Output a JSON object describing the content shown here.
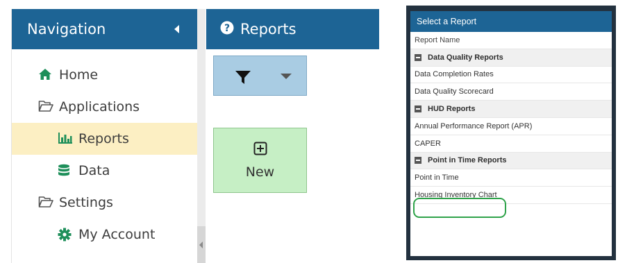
{
  "navigation": {
    "title": "Navigation",
    "items": [
      {
        "label": "Home",
        "icon": "home-icon"
      },
      {
        "label": "Applications",
        "icon": "folder-open-icon"
      },
      {
        "label": "Reports",
        "icon": "bar-chart-icon",
        "active": true
      },
      {
        "label": "Data",
        "icon": "database-icon"
      },
      {
        "label": "Settings",
        "icon": "folder-open-icon"
      },
      {
        "label": "My Account",
        "icon": "gear-icon"
      }
    ]
  },
  "reports": {
    "title": "Reports",
    "new_label": "New"
  },
  "dialog": {
    "title": "Select a Report",
    "column_header": "Report Name",
    "groups": [
      {
        "name": "Data Quality Reports",
        "items": [
          "Data Completion Rates",
          "Data Quality Scorecard"
        ]
      },
      {
        "name": "HUD Reports",
        "items": [
          "Annual Performance Report (APR)",
          "CAPER"
        ]
      },
      {
        "name": "Point in Time Reports",
        "items": [
          "Point in Time",
          "Housing Inventory Chart"
        ]
      }
    ],
    "highlighted_item": "Housing Inventory Chart"
  },
  "colors": {
    "header_blue": "#1d6495",
    "active_nav": "#fcefc3",
    "filter_blue": "#a9cce3",
    "new_green": "#c6efc5",
    "icon_green": "#1e8f5a",
    "highlight_green": "#2ea34a"
  }
}
